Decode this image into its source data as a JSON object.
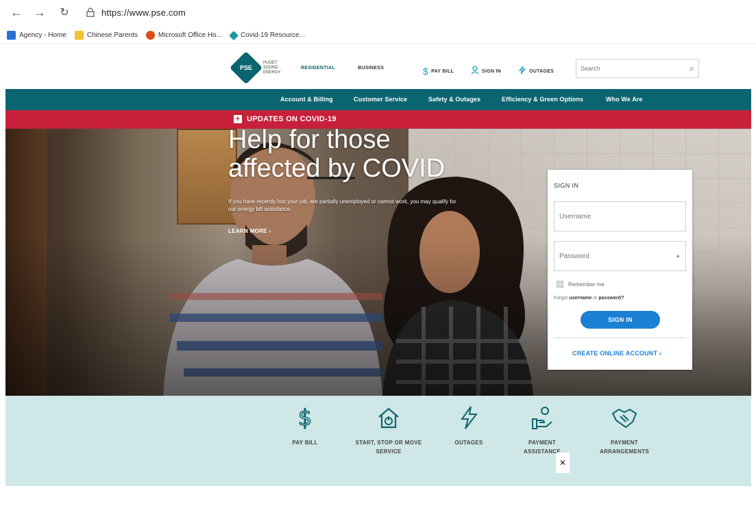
{
  "browser": {
    "url": "https://www.pse.com",
    "bookmarks": [
      "Agency - Home",
      "Chinese Parents",
      "Microsoft Office Ho...",
      "Covid-19 Resource..."
    ]
  },
  "header": {
    "logo_text": "PSE",
    "logo_name": "PUGET SOUND ENERGY",
    "tabs": [
      "RESIDENTIAL",
      "BUSINESS"
    ],
    "utilities": [
      "PAY BILL",
      "SIGN IN",
      "OUTAGES"
    ],
    "search_placeholder": "Search"
  },
  "main_nav": [
    "Account & Billing",
    "Customer Service",
    "Safety & Outages",
    "Efficiency & Green Options",
    "Who We Are"
  ],
  "covid_banner": "UPDATES ON COVID-19",
  "hero": {
    "title": "Help for those affected by COVID",
    "subtitle": "If you have recently lost your job, are partially unemployed or cannot work, you may qualify for our energy bill assistance.",
    "link": "LEARN MORE"
  },
  "signin": {
    "heading": "SIGN IN",
    "username_placeholder": "Username",
    "password_placeholder": "Password",
    "remember": "Remember me",
    "forgot_prefix": "Forgot",
    "forgot_username": "username",
    "forgot_or": "or",
    "forgot_password": "password?",
    "button": "SIGN IN",
    "create": "CREATE ONLINE ACCOUNT"
  },
  "quick_links": [
    {
      "label": "PAY BILL",
      "icon": "dollar-icon"
    },
    {
      "label": "START, STOP OR MOVE SERVICE",
      "icon": "house-power-icon"
    },
    {
      "label": "OUTAGES",
      "icon": "lightning-icon"
    },
    {
      "label": "PAYMENT ASSISTANCE",
      "icon": "hand-coin-icon"
    },
    {
      "label": "PAYMENT ARRANGEMENTS",
      "icon": "handshake-icon"
    }
  ],
  "colors": {
    "teal": "#0b6570",
    "red": "#c8203a",
    "blue": "#1b7fd4",
    "mint": "#cfe7e6"
  }
}
